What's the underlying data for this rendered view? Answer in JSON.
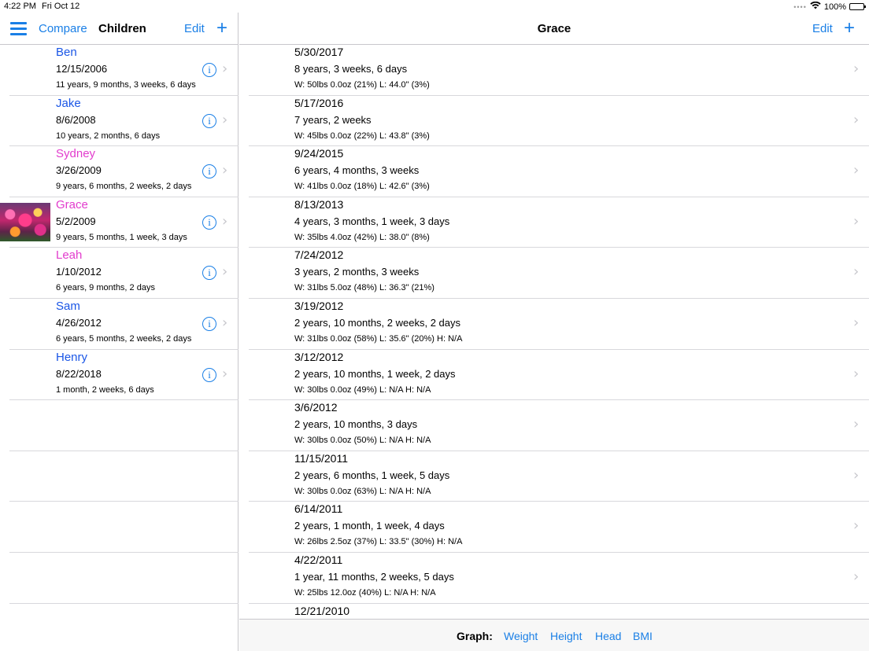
{
  "status": {
    "time": "4:22 PM",
    "date": "Fri Oct 12",
    "battery": "100%"
  },
  "left_nav": {
    "compare_label": "Compare",
    "title": "Children",
    "edit_label": "Edit"
  },
  "children": [
    {
      "name": "Ben",
      "dob": "12/15/2006",
      "age": "11 years, 9 months, 3 weeks, 6 days",
      "color": "#1a56e6"
    },
    {
      "name": "Jake",
      "dob": "8/6/2008",
      "age": "10 years, 2 months, 6 days",
      "color": "#1a56e6"
    },
    {
      "name": "Sydney",
      "dob": "3/26/2009",
      "age": "9 years, 6 months, 2 weeks, 2 days",
      "color": "#e23ccd"
    },
    {
      "name": "Grace",
      "dob": "5/2/2009",
      "age": "9 years, 5 months, 1 week, 3 days",
      "color": "#e23ccd"
    },
    {
      "name": "Leah",
      "dob": "1/10/2012",
      "age": "6 years, 9 months, 2 days",
      "color": "#e23ccd"
    },
    {
      "name": "Sam",
      "dob": "4/26/2012",
      "age": "6 years, 5 months, 2 weeks, 2 days",
      "color": "#1a56e6"
    },
    {
      "name": "Henry",
      "dob": "8/22/2018",
      "age": "1 month, 2 weeks, 6 days",
      "color": "#1a56e6"
    }
  ],
  "right_nav": {
    "title": "Grace",
    "edit_label": "Edit"
  },
  "entries": [
    {
      "date": "5/30/2017",
      "age": "8 years, 3 weeks, 6 days",
      "meas": "W: 50lbs 0.0oz (21%) L: 44.0\" (3%)"
    },
    {
      "date": "5/17/2016",
      "age": "7 years, 2 weeks",
      "meas": "W: 45lbs 0.0oz (22%) L: 43.8\" (3%)"
    },
    {
      "date": "9/24/2015",
      "age": "6 years, 4 months, 3 weeks",
      "meas": "W: 41lbs 0.0oz (18%) L: 42.6\" (3%)"
    },
    {
      "date": "8/13/2013",
      "age": "4 years, 3 months, 1 week, 3 days",
      "meas": "W: 35lbs 4.0oz (42%) L: 38.0\" (8%)"
    },
    {
      "date": "7/24/2012",
      "age": "3 years, 2 months, 3 weeks",
      "meas": "W: 31lbs 5.0oz (48%) L: 36.3\" (21%)"
    },
    {
      "date": "3/19/2012",
      "age": "2 years, 10 months, 2 weeks, 2 days",
      "meas": "W: 31lbs 0.0oz (58%) L: 35.6\" (20%) H: N/A"
    },
    {
      "date": "3/12/2012",
      "age": "2 years, 10 months, 1 week, 2 days",
      "meas": "W: 30lbs 0.0oz (49%) L: N/A H: N/A"
    },
    {
      "date": "3/6/2012",
      "age": "2 years, 10 months, 3 days",
      "meas": "W: 30lbs 0.0oz (50%) L: N/A H: N/A"
    },
    {
      "date": "11/15/2011",
      "age": "2 years, 6 months, 1 week, 5 days",
      "meas": "W: 30lbs 0.0oz (63%) L: N/A H: N/A"
    },
    {
      "date": "6/14/2011",
      "age": "2 years, 1 month, 1 week, 4 days",
      "meas": "W: 26lbs 2.5oz (37%) L: 33.5\" (30%) H: N/A"
    },
    {
      "date": "4/22/2011",
      "age": "1 year, 11 months, 2 weeks, 5 days",
      "meas": "W: 25lbs 12.0oz (40%) L: N/A H: N/A"
    },
    {
      "date": "12/21/2010",
      "age": "",
      "meas": ""
    }
  ],
  "graph_bar": {
    "label": "Graph:",
    "weight": "Weight",
    "height": "Height",
    "head": "Head",
    "bmi": "BMI"
  }
}
